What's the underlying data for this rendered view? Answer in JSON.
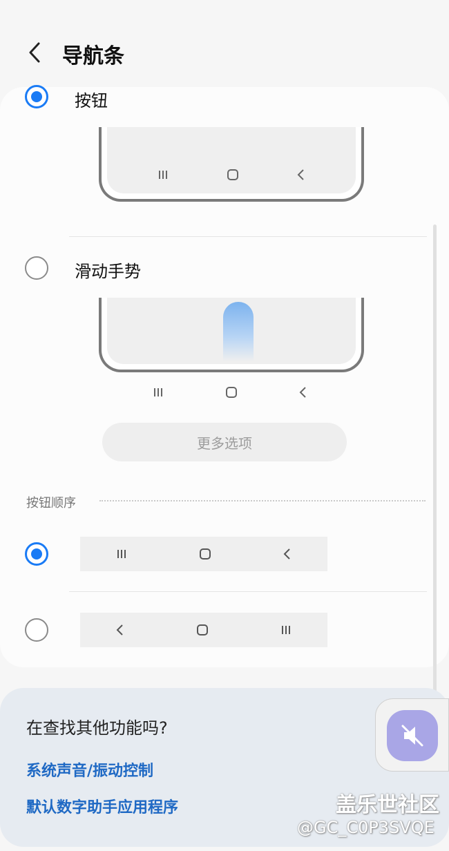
{
  "header": {
    "title": "导航条"
  },
  "nav_type": {
    "options": [
      {
        "label": "按钮",
        "checked": true
      },
      {
        "label": "滑动手势",
        "checked": false
      }
    ],
    "more_options": "更多选项"
  },
  "button_order": {
    "label": "按钮顺序",
    "options": [
      {
        "checked": true,
        "icons": [
          "recents-icon",
          "home-icon",
          "back-icon"
        ]
      },
      {
        "checked": false,
        "icons": [
          "back-icon",
          "home-icon",
          "recents-icon"
        ]
      }
    ]
  },
  "bottom": {
    "title": "在查找其他功能吗?",
    "links": [
      "系统声音/振动控制",
      "默认数字助手应用程序"
    ]
  },
  "floating": {
    "icon": "mute-icon",
    "color": "#a9a6e6"
  },
  "watermark": {
    "line1": "盖乐世社区",
    "line2": "@GC_C0P3SVQE"
  },
  "colors": {
    "accent": "#1a7bf5",
    "link": "#1f69c4"
  }
}
